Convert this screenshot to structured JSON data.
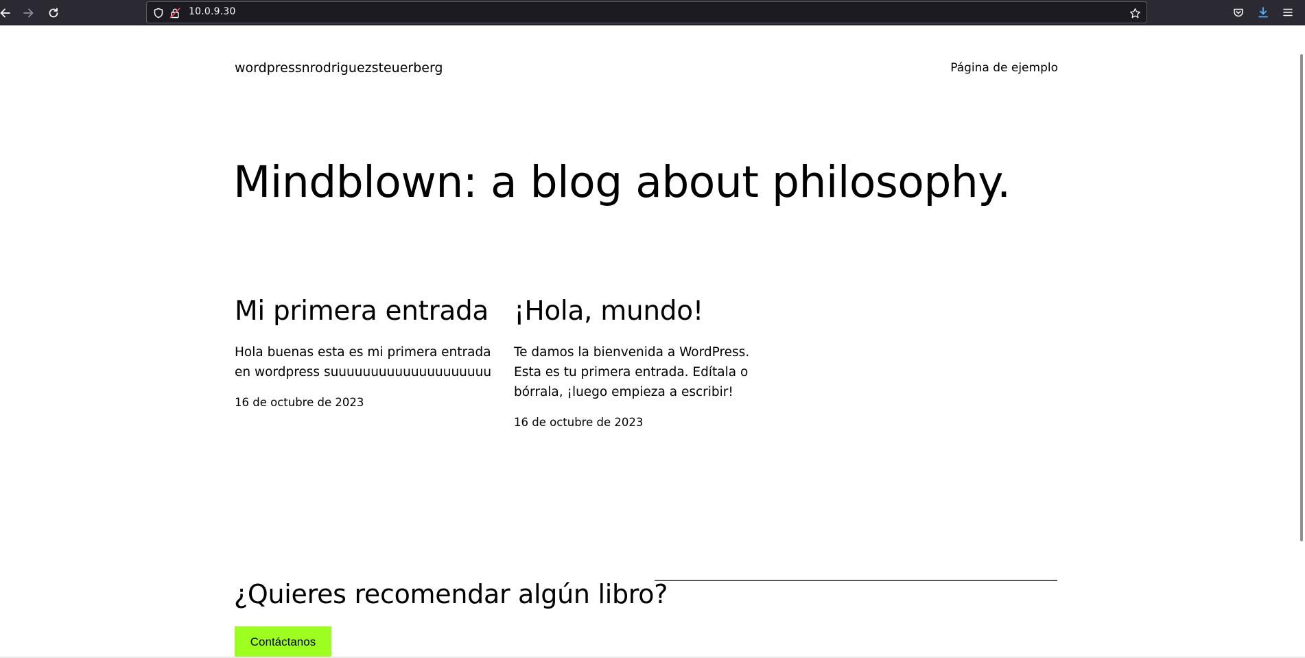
{
  "browser": {
    "url": "10.0.9.30",
    "back_icon": "back-arrow-icon",
    "forward_icon": "forward-arrow-icon",
    "reload_icon": "reload-icon",
    "shield_icon": "shield-icon",
    "lock_icon": "insecure-lock-icon",
    "bookmark_icon": "star-icon",
    "pocket_icon": "pocket-icon",
    "download_icon": "download-icon",
    "menu_icon": "hamburger-menu-icon",
    "download_color": "#54ffbd"
  },
  "header": {
    "site_title": "wordpressnrodriguezsteuerberg",
    "nav_link": "Página de ejemplo"
  },
  "hero": {
    "title": "Mindblown: a blog about philosophy."
  },
  "posts": [
    {
      "title": "Mi primera entrada",
      "excerpt": "Hola buenas esta es mi primera entrada en wordpress suuuuuuuuuuuuuuuuuuuu",
      "date": "16 de octubre de 2023"
    },
    {
      "title": "¡Hola, mundo!",
      "excerpt": "Te damos la bienvenida a WordPress. Esta es tu primera entrada. Edítala o bórrala, ¡luego empieza a escribir!",
      "date": "16 de octubre de 2023"
    }
  ],
  "cta": {
    "title": "¿Quieres recomendar algún libro?",
    "button_label": "Contáctanos",
    "button_color": "#9dff20"
  }
}
